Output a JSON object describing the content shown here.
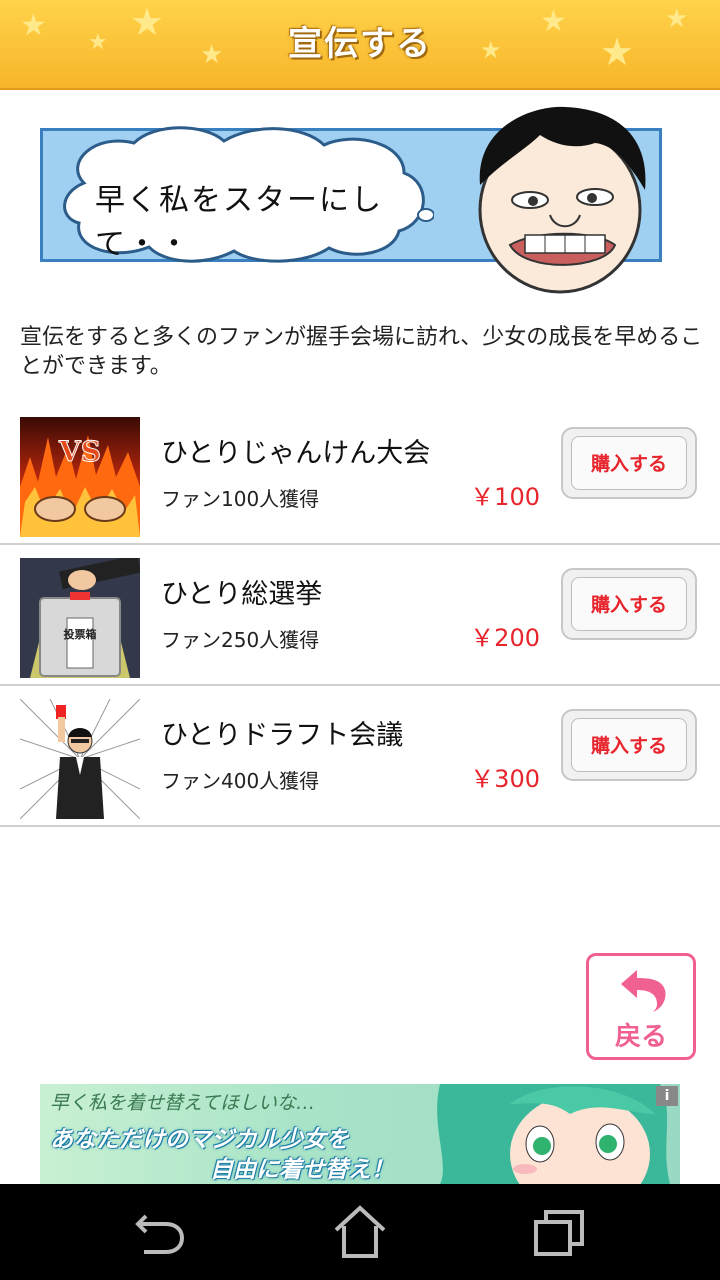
{
  "header": {
    "title": "宣伝する"
  },
  "banner": {
    "speech": "早く私をスターにして・・"
  },
  "description": "宣伝をすると多くのファンが握手会場に訪れ、少女の成長を早めることができます。",
  "items": [
    {
      "title": "ひとりじゃんけん大会",
      "fans": "ファン100人獲得",
      "price": "￥100",
      "button": "購入する",
      "thumb_text": "VS"
    },
    {
      "title": "ひとり総選挙",
      "fans": "ファン250人獲得",
      "price": "￥200",
      "button": "購入する",
      "thumb_text": "投票箱"
    },
    {
      "title": "ひとりドラフト会議",
      "fans": "ファン400人獲得",
      "price": "￥300",
      "button": "購入する"
    }
  ],
  "back": {
    "label": "戻る"
  },
  "ad": {
    "line1": "早く私を着せ替えてほしいな…",
    "line2": "あなただけのマジカル少女を",
    "line3": "自由に着せ替え！",
    "info": "i"
  },
  "navbar": {
    "icons": [
      "back-icon",
      "home-icon",
      "recent-apps-icon"
    ]
  }
}
